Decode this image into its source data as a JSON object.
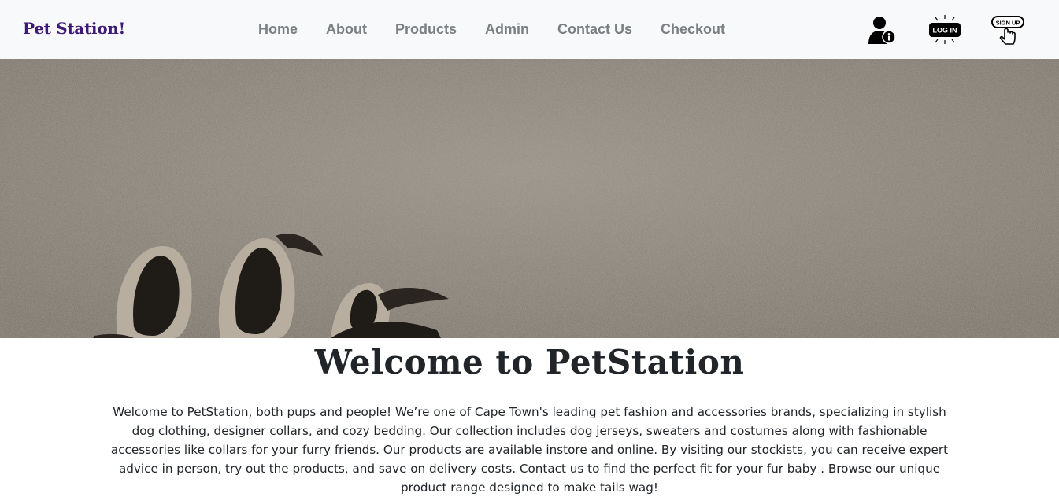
{
  "brand": {
    "name": "Pet Station!",
    "color": "#3d1a78"
  },
  "nav": {
    "links": [
      {
        "label": "Home"
      },
      {
        "label": "About"
      },
      {
        "label": "Products"
      },
      {
        "label": "Admin"
      },
      {
        "label": "Contact Us"
      },
      {
        "label": "Checkout"
      }
    ],
    "icons": [
      {
        "name": "user-info-icon"
      },
      {
        "name": "login-icon",
        "text": "LOG IN"
      },
      {
        "name": "signup-icon",
        "text": "SIGN UP"
      }
    ]
  },
  "hero": {
    "image": "pawprint-in-sand"
  },
  "main": {
    "title": "Welcome to PetStation",
    "intro": "Welcome to PetStation, both pups and people! We’re one of Cape Town's leading pet fashion and accessories brands, specializing in stylish dog clothing, designer collars, and cozy bedding. Our collection includes dog jerseys, sweaters and costumes along with fashionable accessories like collars for your furry friends. Our products are available instore and online. By visiting our stockists, you can receive expert advice in person, try out the products, and save on delivery costs. Contact us to find the perfect fit for your fur baby . Browse our unique product range designed to make tails wag!"
  },
  "colors": {
    "navbar_bg": "#f8f9fa",
    "nav_link": "#7b7f84",
    "text": "#212529"
  }
}
